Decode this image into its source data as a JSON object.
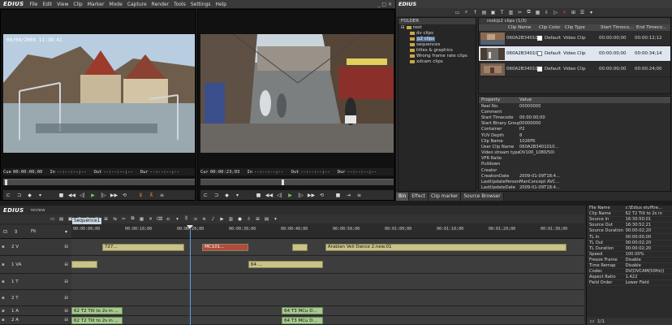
{
  "app": {
    "logo": "EDIUS",
    "menu": [
      "File",
      "Edit",
      "View",
      "Clip",
      "Marker",
      "Mode",
      "Capture",
      "Render",
      "Tools",
      "Settings",
      "Help"
    ]
  },
  "player": {
    "timestamp_overlay": "04/04/2009 11:38:41",
    "cue_label": "Cue",
    "cue_value": "00:00:00;00",
    "in_label": "In",
    "in_value": "--:--:--;--",
    "out_label": "Out",
    "out_value": "--:--:--;--",
    "dur_label": "Dur",
    "dur_value": "--:--:--;--"
  },
  "recorder": {
    "cur_label": "Cur",
    "cur_value": "00:00:23;03",
    "in_label": "In",
    "in_value": "--:--:--;--",
    "out_label": "Out",
    "out_value": "--:--:--;--",
    "dur_label": "Dur",
    "dur_value": "--:--:--;--"
  },
  "bin": {
    "title": "EDIUS",
    "folder_header": "FOLDER",
    "tree": [
      {
        "label": "root",
        "indent": 0
      },
      {
        "label": "dv clips",
        "indent": 1
      },
      {
        "label": "p2 clips",
        "indent": 1,
        "selected": true
      },
      {
        "label": "sequences",
        "indent": 1
      },
      {
        "label": "titles & graphics",
        "indent": 1
      },
      {
        "label": "Wrong frame rate clips",
        "indent": 1
      },
      {
        "label": "xdcam clips",
        "indent": 1
      }
    ],
    "path": "root/p2 clips (1/3)",
    "columns": [
      "Clip Name",
      "Clip Color",
      "Clip Type",
      "Start Timeco...",
      "End Timeco..."
    ],
    "rows": [
      {
        "name": "060A2B34010...",
        "color": "Default",
        "type": "Video Clip",
        "start": "00:00:00;00",
        "end": "00:00:12;12"
      },
      {
        "name": "060A2B34010...",
        "color": "Default",
        "type": "Video Clip",
        "start": "00:00:00;00",
        "end": "00:00:34;14"
      },
      {
        "name": "060A2B34010...",
        "color": "Default",
        "type": "Video Clip",
        "start": "00:00:00;00",
        "end": "00:00:24;00"
      }
    ],
    "prop_columns": [
      "Property",
      "Value"
    ],
    "properties": [
      [
        "Reel No.",
        "00000000"
      ],
      [
        "Comment",
        ""
      ],
      [
        "Start Timecode",
        "00:00:00;00"
      ],
      [
        "Start Binary Group",
        "00000000"
      ],
      [
        "Container",
        "P2"
      ],
      [
        "YUV Depth",
        "8"
      ],
      [
        "Clip Name",
        "1026FK"
      ],
      [
        "User Clip Name",
        "060A2B3401010..."
      ],
      [
        "Video stream type",
        "DV100_1080/50i"
      ],
      [
        "VFR Ratio",
        ""
      ],
      [
        "Pulldown",
        ""
      ],
      [
        "Creator",
        ""
      ],
      [
        "CreationDate",
        "2009-01-09T18:4..."
      ],
      [
        "LastUpdatePerson",
        "ManConcept AVC..."
      ],
      [
        "LastUpdateDate",
        "2009-01-09T18:4..."
      ],
      [
        "Shooter",
        ""
      ]
    ],
    "tabs": [
      "Bin",
      "Effect",
      "Clip marker",
      "Source Browser"
    ]
  },
  "timeline": {
    "title": "EDIUS",
    "subtitle": "review",
    "sequence_tab": "Sequence1",
    "fit_label": "Fit",
    "ruler": [
      "00:00:00;00",
      "00:00:10;00",
      "00:00:20;00",
      "00:00:30;00",
      "00:00:40;00",
      "00:00:50;00",
      "00:01:00;00",
      "00:01:10;00",
      "00:01:20;00",
      "00:01:30;00"
    ],
    "tracks": [
      {
        "label": "2 V",
        "clips": [
          {
            "text": "727...",
            "start": 0.06,
            "end": 0.22,
            "kind": "video"
          },
          {
            "text": "MC101...",
            "start": 0.255,
            "end": 0.345,
            "kind": "red"
          },
          {
            "text": "",
            "start": 0.43,
            "end": 0.46,
            "kind": "video"
          },
          {
            "text": "Arabian Veil Dance 2.new.01",
            "start": 0.495,
            "end": 0.965,
            "kind": "video"
          }
        ]
      },
      {
        "label": "1 VA",
        "clips": [
          {
            "text": "",
            "start": 0.0,
            "end": 0.05,
            "kind": "video"
          },
          {
            "text": "64 ...",
            "start": 0.345,
            "end": 0.49,
            "kind": "video"
          }
        ]
      },
      {
        "label": "1 T",
        "clips": []
      },
      {
        "label": "2 T",
        "clips": []
      },
      {
        "label": "1 A",
        "clips": [
          {
            "text": "62 T2 Tilt to 2s in ...",
            "start": 0.0,
            "end": 0.1,
            "kind": "audio"
          },
          {
            "text": "64 T3 MCu D...",
            "start": 0.41,
            "end": 0.49,
            "kind": "audio"
          }
        ]
      },
      {
        "label": "2 A",
        "clips": [
          {
            "text": "62 T2 Tilt to 2s in ...",
            "start": 0.0,
            "end": 0.1,
            "kind": "audio"
          },
          {
            "text": "64 T3 MCu D...",
            "start": 0.41,
            "end": 0.49,
            "kind": "audio"
          }
        ]
      }
    ]
  },
  "info": {
    "rows": [
      [
        "File Name",
        "c:\\Edius stuff\\re..."
      ],
      [
        "Clip Name",
        "62 T2 Tilt to 2s in"
      ],
      [
        "Source In",
        "16:30:50;01"
      ],
      [
        "Source Out",
        "16:30:52;21"
      ],
      [
        "Source Duration",
        "00:00:02;20"
      ],
      [
        "TL In",
        "00:00:00;00"
      ],
      [
        "TL Out",
        "00:00:02;20"
      ],
      [
        "TL Duration",
        "00:00:02;20"
      ],
      [
        "Speed",
        "100.00%"
      ],
      [
        "Freeze Frame",
        "Disable"
      ],
      [
        "Time Remap",
        "Disable"
      ],
      [
        "Codec",
        "DV(DVCAM(50Hz))"
      ],
      [
        "Aspect Ratio",
        "1.422"
      ],
      [
        "Field Order",
        "Lower Field"
      ]
    ],
    "page": "1/1"
  }
}
